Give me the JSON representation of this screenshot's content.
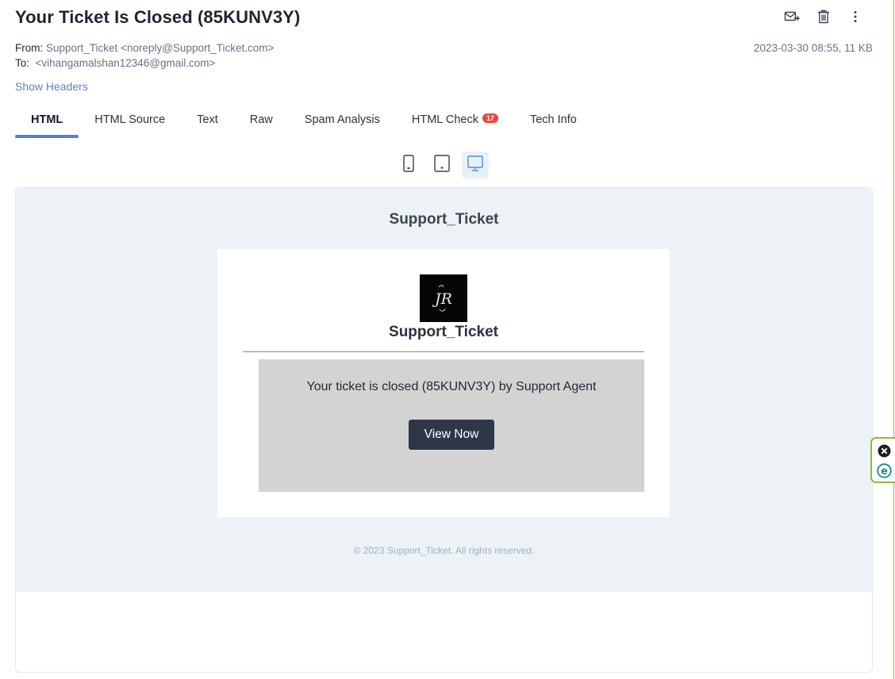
{
  "message": {
    "subject": "Your Ticket Is Closed (85KUNV3Y)",
    "from_label": "From:",
    "from_value": "Support_Ticket <noreply@Support_Ticket.com>",
    "to_label": "To:",
    "to_value": "<vihangamalshan12346@gmail.com>",
    "date_size": "2023-03-30 08:55, 11 KB",
    "show_headers": "Show Headers"
  },
  "toolbar": {
    "icons": [
      "forward-mail-icon",
      "trash-icon",
      "more-vertical-icon"
    ]
  },
  "tabs": [
    {
      "label": "HTML",
      "active": true
    },
    {
      "label": "HTML Source"
    },
    {
      "label": "Text"
    },
    {
      "label": "Raw"
    },
    {
      "label": "Spam Analysis"
    },
    {
      "label": "HTML Check",
      "badge": "17"
    },
    {
      "label": "Tech Info"
    }
  ],
  "device_toggle": {
    "options": [
      "phone-icon",
      "tablet-icon",
      "desktop-icon"
    ],
    "selected": "desktop-icon"
  },
  "email": {
    "brand_top": "Support_Ticket",
    "logo_text": "JR",
    "brand_card": "Support_Ticket",
    "ticket_message": "Your ticket is closed (85KUNV3Y) by Support Agent",
    "button_label": "View Now",
    "footer": "© 2023 Support_Ticket. All rights reserved."
  },
  "colors": {
    "accent": "#4f7fe0",
    "badge": "#ef4444",
    "email_bg": "#edf2f7",
    "button": "#2d3748",
    "inner_box": "#d3d3d3",
    "side_border": "#8dbb3d"
  }
}
